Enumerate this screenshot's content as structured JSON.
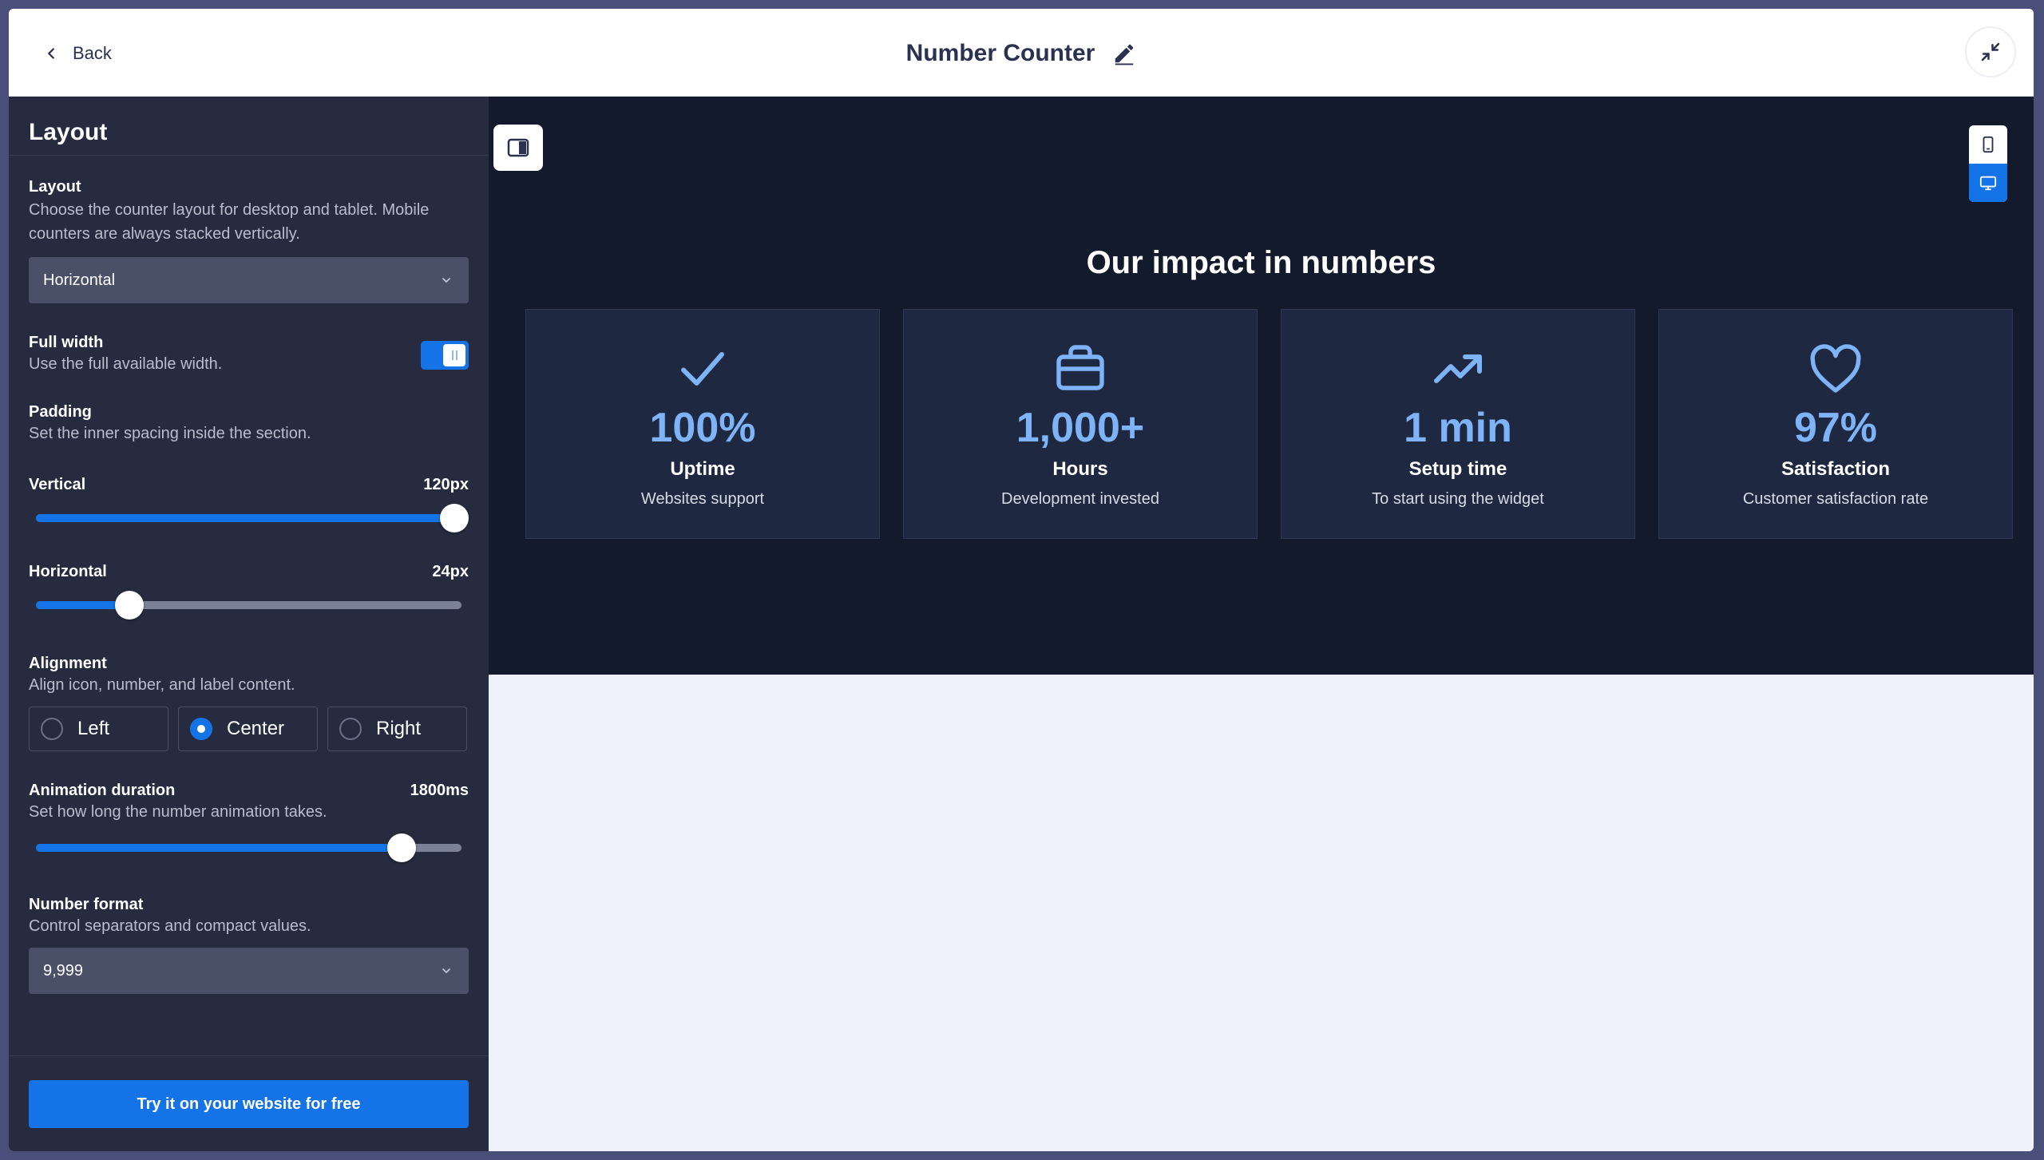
{
  "header": {
    "back_label": "Back",
    "title": "Number Counter"
  },
  "sidebar": {
    "section_title": "Layout",
    "layout": {
      "label": "Layout",
      "description": "Choose the counter layout for desktop and tablet. Mobile counters are always stacked vertically.",
      "selected": "Horizontal"
    },
    "full_width": {
      "label": "Full width",
      "description": "Use the full available width.",
      "enabled": true
    },
    "padding": {
      "label": "Padding",
      "description": "Set the inner spacing inside the section.",
      "vertical": {
        "label": "Vertical",
        "value_text": "120px",
        "fraction": 1.0
      },
      "horizontal": {
        "label": "Horizontal",
        "value_text": "24px",
        "fraction": 0.22
      }
    },
    "alignment": {
      "label": "Alignment",
      "description": "Align icon, number, and label content.",
      "options": [
        "Left",
        "Center",
        "Right"
      ],
      "selected": "Center"
    },
    "animation": {
      "label": "Animation duration",
      "value_text": "1800ms",
      "description": "Set how long the number animation takes.",
      "fraction": 0.86
    },
    "number_format": {
      "label": "Number format",
      "description": "Control separators and compact values.",
      "selected": "9,999"
    },
    "cta_label": "Try it on your website for free"
  },
  "preview": {
    "heading": "Our impact in numbers",
    "counters": [
      {
        "icon": "check-icon",
        "number": "100%",
        "label": "Uptime",
        "sub": "Websites support"
      },
      {
        "icon": "briefcase-icon",
        "number": "1,000+",
        "label": "Hours",
        "sub": "Development invested"
      },
      {
        "icon": "trending-up-icon",
        "number": "1 min",
        "label": "Setup time",
        "sub": "To start using the widget"
      },
      {
        "icon": "heart-icon",
        "number": "97%",
        "label": "Satisfaction",
        "sub": "Customer satisfaction rate"
      }
    ],
    "active_device": "desktop"
  },
  "colors": {
    "accent": "#1473e6",
    "counter_number": "#7eb3f7",
    "preview_background": "#131a2c",
    "sidebar_background": "#262b3f"
  }
}
